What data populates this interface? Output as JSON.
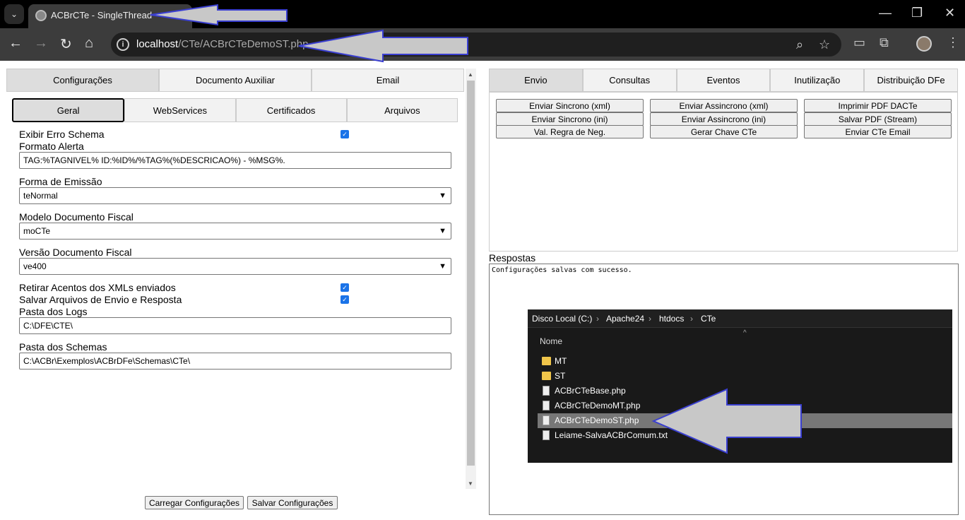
{
  "browser": {
    "tab_title": "ACBrCTe - SingleThread",
    "tab_close": "×",
    "new_tab": "+",
    "url_host": "localhost",
    "url_path": "/CTe/ACBrCTeDemoST.php"
  },
  "left": {
    "main_tabs": [
      "Configurações",
      "Documento Auxiliar",
      "Email"
    ],
    "sub_tabs": [
      "Geral",
      "WebServices",
      "Certificados",
      "Arquivos"
    ],
    "exibir_erro_label": "Exibir Erro Schema",
    "formato_alerta_label": "Formato Alerta",
    "formato_alerta_value": "TAG:%TAGNIVEL% ID:%ID%/%TAG%(%DESCRICAO%) - %MSG%.",
    "forma_emissao_label": "Forma de Emissão",
    "forma_emissao_value": "teNormal",
    "modelo_label": "Modelo Documento Fiscal",
    "modelo_value": "moCTe",
    "versao_label": "Versão Documento Fiscal",
    "versao_value": "ve400",
    "retirar_acentos_label": "Retirar Acentos dos XMLs enviados",
    "salvar_arquivos_label": "Salvar Arquivos de Envio e Resposta",
    "pasta_logs_label": "Pasta dos Logs",
    "pasta_logs_value": "C:\\DFE\\CTE\\",
    "pasta_schemas_label": "Pasta dos Schemas",
    "pasta_schemas_value": "C:\\ACBr\\Exemplos\\ACBrDFe\\Schemas\\CTe\\",
    "carregar_button": "Carregar Configurações",
    "salvar_button": "Salvar Configurações"
  },
  "right": {
    "tabs": [
      "Envio",
      "Consultas",
      "Eventos",
      "Inutilização",
      "Distribuição DFe"
    ],
    "buttons": [
      "Enviar Sincrono (xml)",
      "Enviar Assincrono (xml)",
      "Imprimir PDF DACTe",
      "Enviar Sincrono (ini)",
      "Enviar Assincrono (ini)",
      "Salvar PDF (Stream)",
      "Val. Regra de Neg.",
      "Gerar Chave CTe",
      "Enviar CTe Email"
    ],
    "respostas_label": "Respostas",
    "respostas_text": "Configurações salvas com sucesso."
  },
  "explorer": {
    "breadcrumb": [
      "Disco Local (C:)",
      "Apache24",
      "htdocs",
      "CTe"
    ],
    "column_header": "Nome",
    "items": [
      {
        "name": "MT",
        "type": "folder"
      },
      {
        "name": "ST",
        "type": "folder"
      },
      {
        "name": "ACBrCTeBase.php",
        "type": "file"
      },
      {
        "name": "ACBrCTeDemoMT.php",
        "type": "file"
      },
      {
        "name": "ACBrCTeDemoST.php",
        "type": "file",
        "selected": true
      },
      {
        "name": "Leiame-SalvaACBrComum.txt",
        "type": "file"
      }
    ]
  },
  "colors": {
    "arrow_fill": "#c8c8c8",
    "arrow_stroke": "#3a3fd0",
    "checkbox": "#1a73e8"
  }
}
